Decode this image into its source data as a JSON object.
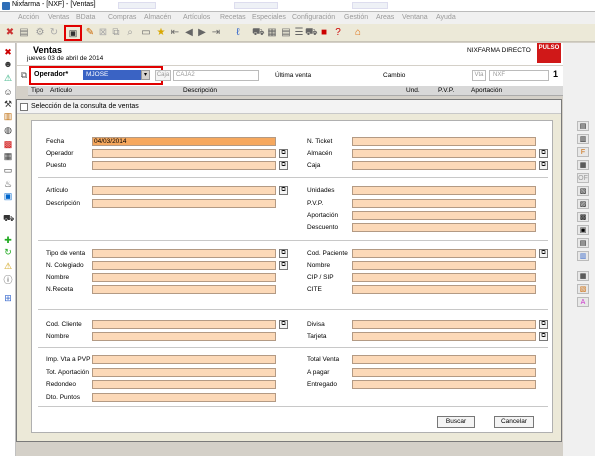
{
  "window": {
    "title": "Nixfarma - [NXF] - [Ventas]"
  },
  "menu": [
    "Acción",
    "Ventas",
    "BData",
    "Compras",
    "Almacén",
    "Artículos",
    "Recetas",
    "Especiales",
    "Configuración",
    "Gestión",
    "Areas",
    "Ventana",
    "Ayuda"
  ],
  "header": {
    "title": "Ventas",
    "date": "jueves 03 de abril de 2014",
    "brand": "NIXFARMA DIRECTO",
    "logo": "PULSO"
  },
  "operbar": {
    "operador_label": "Operador*",
    "operador_value": "MJOSE",
    "caja_label": "Caja",
    "caja_value": "CAJA2",
    "ultima_label": "Última venta",
    "cambio_label": "Cambio",
    "vta_label": "Vta",
    "moneda": "NXF",
    "count": "1"
  },
  "columns": [
    "Tipo",
    "Artículo",
    "Descripción",
    "Und.",
    "P.V.P.",
    "Aportación"
  ],
  "dialog": {
    "title": "Selección de la consulta de ventas",
    "left_fields": [
      {
        "label": "Fecha",
        "value": "04/03/2014"
      },
      {
        "label": "Operador",
        "value": ""
      },
      {
        "label": "Puesto",
        "value": ""
      },
      {
        "label": "Artículo",
        "value": ""
      },
      {
        "label": "Descripción",
        "value": ""
      },
      {
        "label": "Tipo de venta",
        "value": ""
      },
      {
        "label": "N. Colegiado",
        "value": ""
      },
      {
        "label": "Nombre",
        "value": ""
      },
      {
        "label": "N.Receta",
        "value": ""
      },
      {
        "label": "Cod. Cliente",
        "value": ""
      },
      {
        "label": "Nombre",
        "value": ""
      },
      {
        "label": "Imp. Vta a PVP",
        "value": ""
      },
      {
        "label": "Tot. Aportación",
        "value": ""
      },
      {
        "label": "Redondeo",
        "value": ""
      },
      {
        "label": "Dto. Puntos",
        "value": ""
      }
    ],
    "right_fields": [
      {
        "label": "N. Ticket",
        "value": ""
      },
      {
        "label": "Almacén",
        "value": ""
      },
      {
        "label": "Caja",
        "value": ""
      },
      {
        "label": "Unidades",
        "value": ""
      },
      {
        "label": "P.V.P.",
        "value": ""
      },
      {
        "label": "Aportación",
        "value": ""
      },
      {
        "label": "Descuento",
        "value": ""
      },
      {
        "label": "Cod. Paciente",
        "value": ""
      },
      {
        "label": "Nombre",
        "value": ""
      },
      {
        "label": "CIP / SIP",
        "value": ""
      },
      {
        "label": "CITE",
        "value": ""
      },
      {
        "label": "Divisa",
        "value": ""
      },
      {
        "label": "Tarjeta",
        "value": ""
      },
      {
        "label": "Total Venta",
        "value": ""
      },
      {
        "label": "A pagar",
        "value": ""
      },
      {
        "label": "Entregado",
        "value": ""
      }
    ],
    "buttons": {
      "search": "Buscar",
      "cancel": "Cancelar"
    }
  },
  "colors": {
    "field_bg": "#fcd9b8",
    "highlight": "#e00000",
    "selection": "#3a63c4"
  }
}
